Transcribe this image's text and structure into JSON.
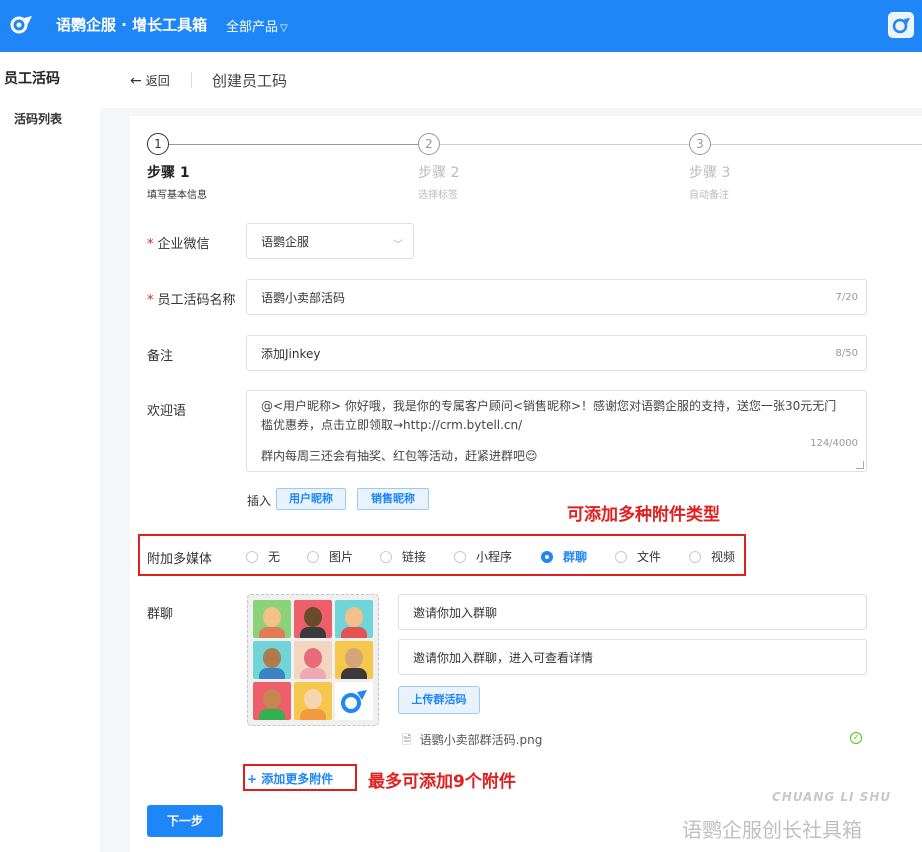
{
  "topbar": {
    "brand": "语鹦企服 · 增长工具箱",
    "products": "全部产品",
    "colors": {
      "bg": "#1e86f7"
    }
  },
  "sidebar": {
    "title": "员工活码",
    "items": [
      {
        "label": "活码列表"
      }
    ]
  },
  "header": {
    "back_label": "返回",
    "title": "创建员工码"
  },
  "steps": [
    {
      "num": "1",
      "title": "步骤 1",
      "sub": "填写基本信息",
      "active": true
    },
    {
      "num": "2",
      "title": "步骤 2",
      "sub": "选择标签",
      "active": false
    },
    {
      "num": "3",
      "title": "步骤 3",
      "sub": "自动备注",
      "active": false
    }
  ],
  "form": {
    "corp": {
      "label": "企业微信",
      "required": "*",
      "value": "语鹦企服"
    },
    "name": {
      "label": "员工活码名称",
      "required": "*",
      "value": "语鹦小卖部活码",
      "counter": "7/20"
    },
    "remark": {
      "label": "备注",
      "value": "添加Jinkey",
      "counter": "8/50"
    },
    "welcome": {
      "label": "欢迎语",
      "line1": "@<用户昵称>  你好哦，我是你的专属客户顾问<销售昵称>！感谢您对语鹦企服的支持，送您一张30元无门",
      "line2": "槛优惠券，点击立即领取→http://crm.bytell.cn/",
      "line3": "群内每周三还会有抽奖、红包等活动，赶紧进群吧😌",
      "counter": "124/4000"
    },
    "insert": {
      "label": "插入",
      "buttons": [
        "用户昵称",
        "销售昵称"
      ]
    },
    "media": {
      "label": "附加多媒体",
      "options": [
        "无",
        "图片",
        "链接",
        "小程序",
        "群聊",
        "文件",
        "视频"
      ],
      "selected": "群聊"
    },
    "group": {
      "label": "群聊",
      "title_value": "邀请你加入群聊",
      "desc_value": "邀请你加入群聊，进入可查看详情",
      "upload_label": "上传群活码",
      "file_name": "语鹦小卖部群活码.png"
    },
    "add_more": "+ 添加更多附件",
    "next": "下一步"
  },
  "annotations": {
    "note1": "可添加多种附件类型",
    "note2": "最多可添加9个附件"
  },
  "watermark": {
    "en": "CHUANG LI SHU",
    "cn": "语鹦企服创长社具箱"
  }
}
